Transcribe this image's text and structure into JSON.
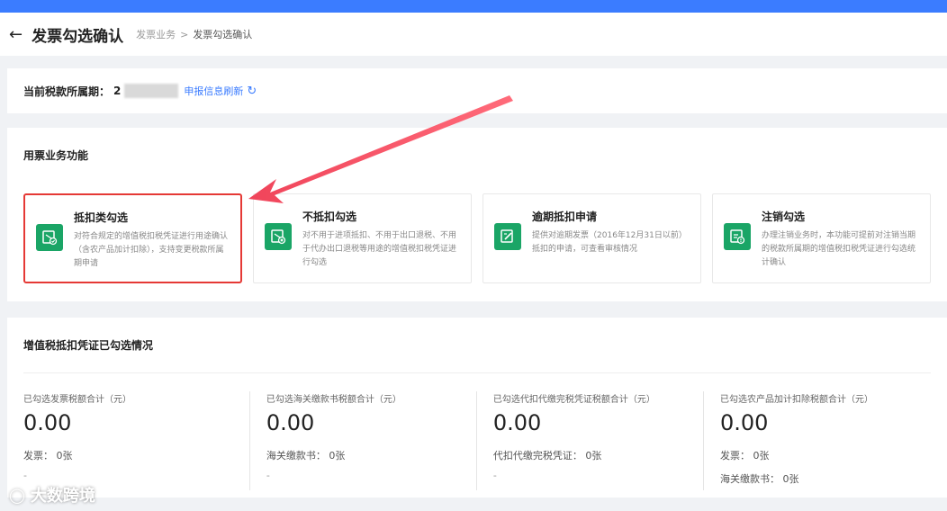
{
  "header": {
    "title": "发票勾选确认",
    "breadcrumb": [
      "发票业务",
      "发票勾选确认"
    ],
    "breadcrumb_sep": ">"
  },
  "period": {
    "label": "当前税款所属期：",
    "value_prefix": "2",
    "refresh_label": "申报信息刷新"
  },
  "functions": {
    "title": "用票业务功能",
    "cards": [
      {
        "title": "抵扣类勾选",
        "desc": "对符合规定的增值税扣税凭证进行用途确认（含农产品加计扣除），支持变更税款所属期申请"
      },
      {
        "title": "不抵扣勾选",
        "desc": "对不用于进项抵扣、不用于出口退税、不用于代办出口退税等用途的增值税扣税凭证进行勾选"
      },
      {
        "title": "逾期抵扣申请",
        "desc": "提供对逾期发票（2016年12月31日以前）抵扣的申请，可查看审核情况"
      },
      {
        "title": "注销勾选",
        "desc": "办理注销业务时，本功能可提前对注销当期的税款所属期的增值税扣税凭证进行勾选统计确认"
      }
    ]
  },
  "stats": {
    "title": "增值税抵扣凭证已勾选情况",
    "items": [
      {
        "label": "已勾选发票税额合计（元）",
        "value": "0.00",
        "lines": [
          "发票：  0张"
        ],
        "dash": "-"
      },
      {
        "label": "已勾选海关缴款书税额合计（元）",
        "value": "0.00",
        "lines": [
          "海关缴款书：  0张"
        ],
        "dash": "-"
      },
      {
        "label": "已勾选代扣代缴完税凭证税额合计（元）",
        "value": "0.00",
        "lines": [
          "代扣代缴完税凭证：  0张"
        ],
        "dash": "-"
      },
      {
        "label": "已勾选农产品加计扣除税额合计（元）",
        "value": "0.00",
        "lines": [
          "发票：  0张",
          "海关缴款书：  0张"
        ],
        "dash": ""
      }
    ]
  },
  "watermark": {
    "text": "大数跨境"
  },
  "colors": {
    "accent": "#3b7cff",
    "icon_green": "#1aa566",
    "highlight_red": "#e53935",
    "arrow_red": "#f0445a"
  }
}
